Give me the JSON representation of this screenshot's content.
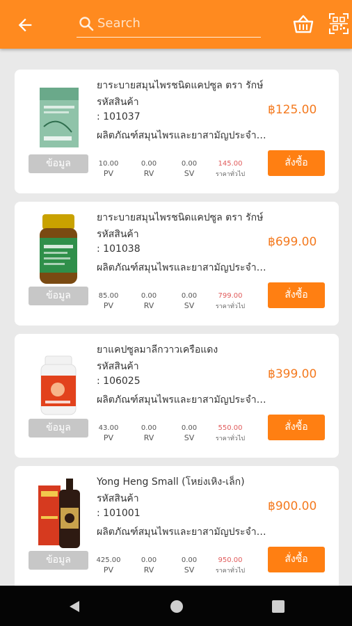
{
  "header": {
    "search_placeholder": "Search"
  },
  "products": [
    {
      "title": "ยาระบายสมุนไพรชนิดแคปซูล ตรา รักษ์",
      "code_label": "รหัสสินค้า",
      "code": ": 101037",
      "description": "ผลิตภัณฑ์สมุนไพรและยาสามัญประจำบ้าน",
      "price": "฿125.00",
      "info_label": "ข้อมูล",
      "buy_label": "สั่งซื้อ",
      "metrics": {
        "pv": "10.00",
        "pv_label": "PV",
        "rv": "0.00",
        "rv_label": "RV",
        "sv": "0.00",
        "sv_label": "SV",
        "retail": "145.00",
        "retail_label": "ราคาทั่วไป"
      }
    },
    {
      "title": "ยาระบายสมุนไพรชนิดแคปซูล ตรา รักษ์",
      "code_label": "รหัสสินค้า",
      "code": ": 101038",
      "description": "ผลิตภัณฑ์สมุนไพรและยาสามัญประจำบ้าน",
      "price": "฿699.00",
      "info_label": "ข้อมูล",
      "buy_label": "สั่งซื้อ",
      "metrics": {
        "pv": "85.00",
        "pv_label": "PV",
        "rv": "0.00",
        "rv_label": "RV",
        "sv": "0.00",
        "sv_label": "SV",
        "retail": "799.00",
        "retail_label": "ราคาทั่วไป"
      }
    },
    {
      "title": "ยาแคปซูลมาลีกวาวเครือแดง",
      "code_label": "รหัสสินค้า",
      "code": ": 106025",
      "description": "ผลิตภัณฑ์สมุนไพรและยาสามัญประจำบ้าน",
      "price": "฿399.00",
      "info_label": "ข้อมูล",
      "buy_label": "สั่งซื้อ",
      "metrics": {
        "pv": "43.00",
        "pv_label": "PV",
        "rv": "0.00",
        "rv_label": "RV",
        "sv": "0.00",
        "sv_label": "SV",
        "retail": "550.00",
        "retail_label": "ราคาทั่วไป"
      }
    },
    {
      "title": "Yong Heng Small (โหย่งเหิง-เล็ก)",
      "code_label": "รหัสสินค้า",
      "code": ": 101001",
      "description": "ผลิตภัณฑ์สมุนไพรและยาสามัญประจำบ้าน",
      "price": "฿900.00",
      "info_label": "ข้อมูล",
      "buy_label": "สั่งซื้อ",
      "metrics": {
        "pv": "425.00",
        "pv_label": "PV",
        "rv": "0.00",
        "rv_label": "RV",
        "sv": "0.00",
        "sv_label": "SV",
        "retail": "950.00",
        "retail_label": "ราคาทั่วไป"
      }
    }
  ],
  "colors": {
    "brand": "#ff8a1f",
    "price": "#f47a1f",
    "buy_button": "#ff7f12",
    "retail_price": "#e05a5a"
  }
}
